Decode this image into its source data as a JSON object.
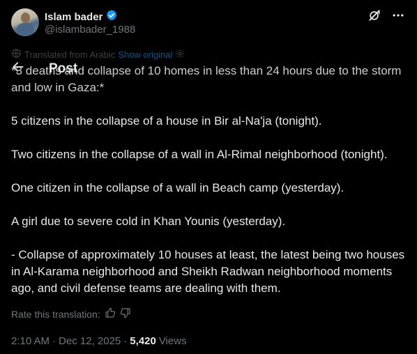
{
  "author": {
    "name": "Islam bader",
    "handle": "@islambader_1988",
    "verified": true
  },
  "header_icons": [
    "grok-icon",
    "more-icon"
  ],
  "translation": {
    "label": "Translated from Arabic",
    "show_original": "Show original"
  },
  "nav": {
    "title": "Post"
  },
  "tweet": {
    "paragraphs": [
      "*3 deaths and collapse of 10 homes in less than 24 hours due to the storm and low in Gaza:*",
      "5 citizens in the collapse of a house in Bir al-Na'ja (tonight).",
      "Two citizens in the collapse of a wall in Al-Rimal neighborhood (tonight).",
      "One citizen in the collapse of a wall in Beach camp (yesterday).",
      "A girl due to severe cold in Khan Younis (yesterday).",
      "- Collapse of approximately 10 houses at least, the latest being two houses in Al-Karama neighborhood and Sheikh Radwan neighborhood moments ago, and civil defense teams are dealing with them."
    ]
  },
  "rate": {
    "label": "Rate this translation:"
  },
  "meta": {
    "time": "2:10 AM",
    "date": "Dec 12, 2025",
    "separator": "·",
    "views_count": "5,420",
    "views_label": "Views"
  },
  "colors": {
    "background": "#000000",
    "text": "#e7e9ea",
    "muted": "#71767b",
    "accent": "#1d9bf0"
  }
}
